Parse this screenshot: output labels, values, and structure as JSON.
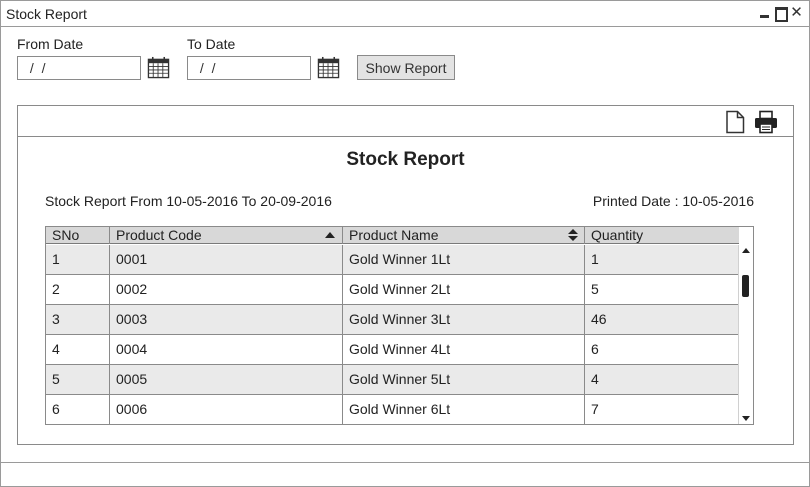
{
  "window": {
    "title": "Stock Report"
  },
  "filters": {
    "from_label": "From Date",
    "from_value": " / /",
    "to_label": "To Date",
    "to_value": " / /",
    "show_button": "Show Report"
  },
  "report": {
    "title": "Stock Report",
    "range_text": "Stock Report From 10-05-2016 To 20-09-2016",
    "printed_text": "Printed Date : 10-05-2016",
    "columns": [
      "SNo",
      "Product Code",
      "Product Name",
      "Quantity"
    ],
    "rows": [
      {
        "sno": "1",
        "code": "0001",
        "name": "Gold Winner 1Lt",
        "qty": "1"
      },
      {
        "sno": "2",
        "code": "0002",
        "name": "Gold Winner 2Lt",
        "qty": "5"
      },
      {
        "sno": "3",
        "code": "0003",
        "name": "Gold Winner 3Lt",
        "qty": "46"
      },
      {
        "sno": "4",
        "code": "0004",
        "name": "Gold Winner 4Lt",
        "qty": "6"
      },
      {
        "sno": "5",
        "code": "0005",
        "name": "Gold Winner 5Lt",
        "qty": "4"
      },
      {
        "sno": "6",
        "code": "0006",
        "name": "Gold Winner 6Lt",
        "qty": "7"
      }
    ]
  },
  "icons": {
    "calendar": "calendar-icon",
    "export": "document-icon",
    "print": "printer-icon",
    "minimize": "minimize-icon",
    "maximize": "maximize-icon",
    "close": "close-icon"
  },
  "colors": {
    "header_bg": "#d8d8d8",
    "alt_row_bg": "#eaeaea",
    "border": "#8a8a8a"
  }
}
